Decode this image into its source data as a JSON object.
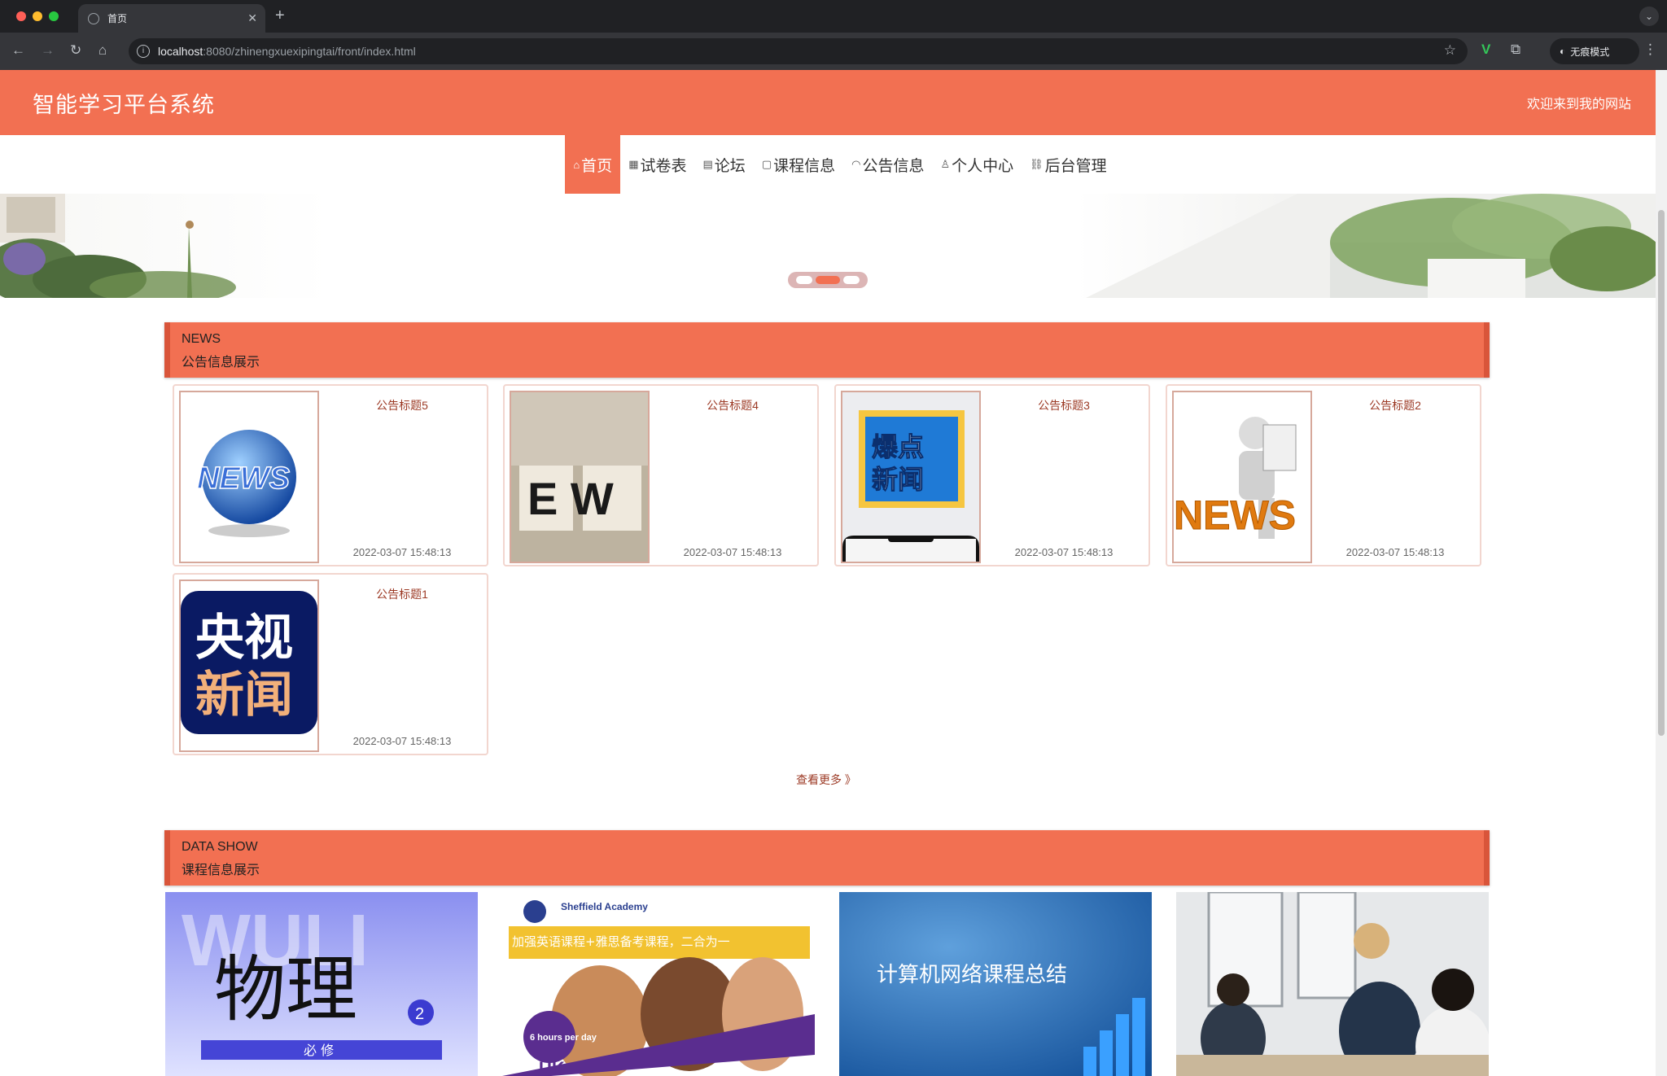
{
  "browser": {
    "tab_title": "首页",
    "url_host": "localhost",
    "url_rest": ":8080/zhinengxuexipingtai/front/index.html",
    "incognito_label": "无痕模式"
  },
  "site": {
    "title": "智能学习平台系统",
    "welcome": "欢迎来到我的网站"
  },
  "nav": {
    "items": [
      {
        "icon": "home-icon",
        "glyph": "⌂",
        "label": "首页"
      },
      {
        "icon": "grid-icon",
        "glyph": "▦",
        "label": "试卷表"
      },
      {
        "icon": "forum-icon",
        "glyph": "▤",
        "label": "论坛"
      },
      {
        "icon": "book-icon",
        "glyph": "▢",
        "label": "课程信息"
      },
      {
        "icon": "speaker-icon",
        "glyph": "◠",
        "label": "公告信息"
      },
      {
        "icon": "user-icon",
        "glyph": "♙",
        "label": "个人中心"
      },
      {
        "icon": "link-icon",
        "glyph": "⛓",
        "label": "后台管理"
      }
    ],
    "active_index": 0
  },
  "news_section": {
    "en": "NEWS",
    "zh": "公告信息展示",
    "cards": [
      {
        "title": "公告标题5",
        "time": "2022-03-07 15:48:13",
        "thumb": "news-globe",
        "thumb_text": "NEWS"
      },
      {
        "title": "公告标题4",
        "time": "2022-03-07 15:48:13",
        "thumb": "news-blocks",
        "thumb_text": "E W"
      },
      {
        "title": "公告标题3",
        "time": "2022-03-07 15:48:13",
        "thumb": "hot-news-phone",
        "thumb_text": "爆点\n新闻"
      },
      {
        "title": "公告标题2",
        "time": "2022-03-07 15:48:13",
        "thumb": "news-reader",
        "thumb_text": "NEWS"
      },
      {
        "title": "公告标题1",
        "time": "2022-03-07 15:48:13",
        "thumb": "cctv-news",
        "thumb_text": "央视\n新闻"
      }
    ],
    "more": "查看更多 》"
  },
  "course_section": {
    "en": "DATA SHOW",
    "zh": "课程信息展示",
    "items": [
      {
        "thumb": "physics-book",
        "text": "物理",
        "sub": "必 修",
        "bg": "WULI",
        "badge": "2"
      },
      {
        "thumb": "english-academy",
        "banner_text": "加强英语课程+雅思备考课程，二合为一",
        "logo": "Sheffield Academy",
        "badge": "6 hours per day",
        "bottom": "UK"
      },
      {
        "thumb": "network-course",
        "text": "计算机网络课程总结"
      },
      {
        "thumb": "classroom-photo"
      }
    ]
  },
  "colors": {
    "primary": "#f27052",
    "primary_dark": "#d9553a",
    "title_text": "#9c3a25"
  }
}
